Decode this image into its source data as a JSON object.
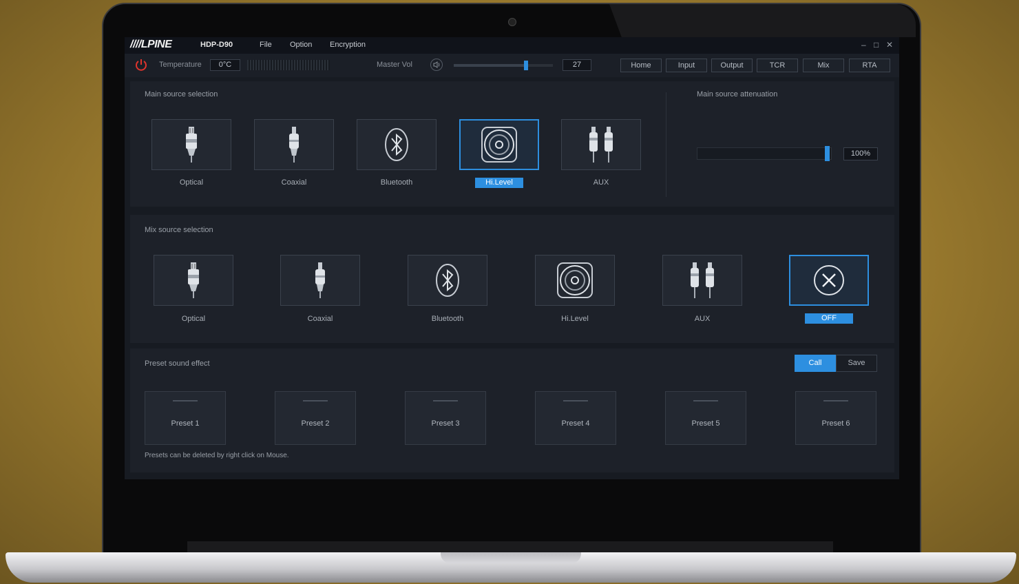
{
  "app": {
    "brand": "////LPINE",
    "model": "HDP-D90"
  },
  "menu": {
    "file": "File",
    "option": "Option",
    "encryption": "Encryption"
  },
  "window_controls": {
    "minimize": "–",
    "maximize": "□",
    "close": "✕"
  },
  "toolbar": {
    "temperature_label": "Temperature",
    "temperature_value": "0°C",
    "master_vol_label": "Master Vol",
    "master_vol_value": "27",
    "master_vol_level": 0.75
  },
  "tabs": [
    {
      "label": "Home",
      "active": true
    },
    {
      "label": "Input",
      "active": false
    },
    {
      "label": "Output",
      "active": false
    },
    {
      "label": "TCR",
      "active": false
    },
    {
      "label": "Mix",
      "active": false
    },
    {
      "label": "RTA",
      "active": false
    }
  ],
  "main_source": {
    "title": "Main source selection",
    "items": [
      {
        "label": "Optical",
        "icon": "optical-icon"
      },
      {
        "label": "Coaxial",
        "icon": "coaxial-icon"
      },
      {
        "label": "Bluetooth",
        "icon": "bluetooth-icon"
      },
      {
        "label": "Hi.Level",
        "icon": "speaker-icon",
        "selected": true
      },
      {
        "label": "AUX",
        "icon": "rca-icon"
      }
    ]
  },
  "attenuation": {
    "title": "Main source attenuation",
    "value": "100%",
    "level": 1.0
  },
  "mix_source": {
    "title": "Mix  source selection",
    "items": [
      {
        "label": "Optical",
        "icon": "optical-icon"
      },
      {
        "label": "Coaxial",
        "icon": "coaxial-icon"
      },
      {
        "label": "Bluetooth",
        "icon": "bluetooth-icon"
      },
      {
        "label": "Hi.Level",
        "icon": "speaker-icon"
      },
      {
        "label": "AUX",
        "icon": "rca-icon"
      },
      {
        "label": "OFF",
        "icon": "close-circle-icon",
        "selected": true
      }
    ]
  },
  "preset": {
    "title": "Preset sound effect",
    "call_label": "Call",
    "save_label": "Save",
    "items": [
      "Preset 1",
      "Preset 2",
      "Preset 3",
      "Preset 4",
      "Preset 5",
      "Preset 6"
    ],
    "note": "Presets can be deleted by right click on Mouse."
  },
  "colors": {
    "accent": "#2d8fe0",
    "power": "#e0342c",
    "background": "#171b22"
  }
}
